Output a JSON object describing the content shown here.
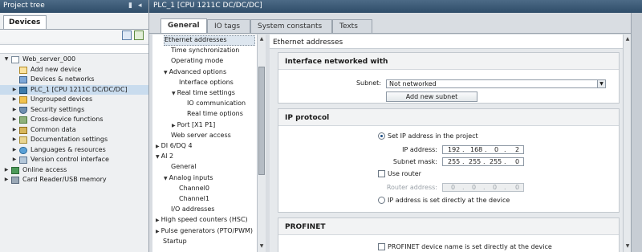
{
  "project_tree": {
    "title": "Project tree",
    "tab": "Devices",
    "items": [
      {
        "label": "Web_server_000",
        "indent": 0,
        "expand": "▼",
        "icon": "doc"
      },
      {
        "label": "Add new device",
        "indent": 1,
        "expand": "",
        "icon": "add"
      },
      {
        "label": "Devices & networks",
        "indent": 1,
        "expand": "",
        "icon": "net"
      },
      {
        "label": "PLC_1 [CPU 1211C DC/DC/DC]",
        "indent": 1,
        "expand": "▶",
        "icon": "plc",
        "selected": true
      },
      {
        "label": "Ungrouped devices",
        "indent": 1,
        "expand": "▶",
        "icon": "folder"
      },
      {
        "label": "Security settings",
        "indent": 1,
        "expand": "▶",
        "icon": "shield"
      },
      {
        "label": "Cross-device functions",
        "indent": 1,
        "expand": "▶",
        "icon": "cross"
      },
      {
        "label": "Common data",
        "indent": 1,
        "expand": "▶",
        "icon": "data"
      },
      {
        "label": "Documentation settings",
        "indent": 1,
        "expand": "▶",
        "icon": "docset"
      },
      {
        "label": "Languages & resources",
        "indent": 1,
        "expand": "▶",
        "icon": "lang"
      },
      {
        "label": "Version control interface",
        "indent": 1,
        "expand": "▶",
        "icon": "vc"
      },
      {
        "label": "Online access",
        "indent": 0,
        "expand": "▶",
        "icon": "online"
      },
      {
        "label": "Card Reader/USB memory",
        "indent": 0,
        "expand": "▶",
        "icon": "card"
      }
    ]
  },
  "editor": {
    "title": "PLC_1 [CPU 1211C DC/DC/DC]",
    "tabs": [
      {
        "label": "General",
        "active": true
      },
      {
        "label": "IO tags",
        "active": false
      },
      {
        "label": "System constants",
        "active": false
      },
      {
        "label": "Texts",
        "active": false
      }
    ],
    "nav": [
      {
        "label": "Ethernet addresses",
        "level": 1,
        "expand": "",
        "selected": true
      },
      {
        "label": "Time synchronization",
        "level": 1,
        "expand": ""
      },
      {
        "label": "Operating mode",
        "level": 1,
        "expand": ""
      },
      {
        "label": "Advanced options",
        "level": 1,
        "expand": "▼"
      },
      {
        "label": "Interface options",
        "level": 2,
        "expand": ""
      },
      {
        "label": "Real time settings",
        "level": 2,
        "expand": "▼"
      },
      {
        "label": "IO communication",
        "level": 3,
        "expand": ""
      },
      {
        "label": "Real time options",
        "level": 3,
        "expand": ""
      },
      {
        "label": "Port [X1 P1]",
        "level": 2,
        "expand": "▶"
      },
      {
        "label": "Web server access",
        "level": 1,
        "expand": ""
      },
      {
        "label": "DI 6/DQ 4",
        "level": 0,
        "expand": "▶"
      },
      {
        "label": "AI 2",
        "level": 0,
        "expand": "▼"
      },
      {
        "label": "General",
        "level": 1,
        "expand": ""
      },
      {
        "label": "Analog inputs",
        "level": 1,
        "expand": "▼"
      },
      {
        "label": "Channel0",
        "level": 2,
        "expand": ""
      },
      {
        "label": "Channel1",
        "level": 2,
        "expand": ""
      },
      {
        "label": "I/O addresses",
        "level": 1,
        "expand": ""
      },
      {
        "label": "High speed counters (HSC)",
        "level": 0,
        "expand": "▶"
      },
      {
        "label": "Pulse generators (PTO/PWM)",
        "level": 0,
        "expand": "▶"
      },
      {
        "label": "Startup",
        "level": 0,
        "expand": ""
      }
    ],
    "content": {
      "header": "Ethernet addresses",
      "interface": {
        "title": "Interface networked with",
        "subnet_label": "Subnet:",
        "subnet_value": "Not networked",
        "add_subnet_button": "Add new subnet"
      },
      "ip_protocol": {
        "title": "IP protocol",
        "set_in_project": "Set IP address in the project",
        "ip_label": "IP address:",
        "ip": [
          "192",
          "168",
          "0",
          "2"
        ],
        "mask_label": "Subnet mask:",
        "mask": [
          "255",
          "255",
          "255",
          "0"
        ],
        "use_router": "Use router",
        "router_label": "Router address:",
        "router": [
          "0",
          "0",
          "0",
          "0"
        ],
        "set_directly": "IP address is set directly at the device"
      },
      "profinet": {
        "title": "PROFINET",
        "name_directly": "PROFINET device name is set directly at the device"
      }
    }
  }
}
